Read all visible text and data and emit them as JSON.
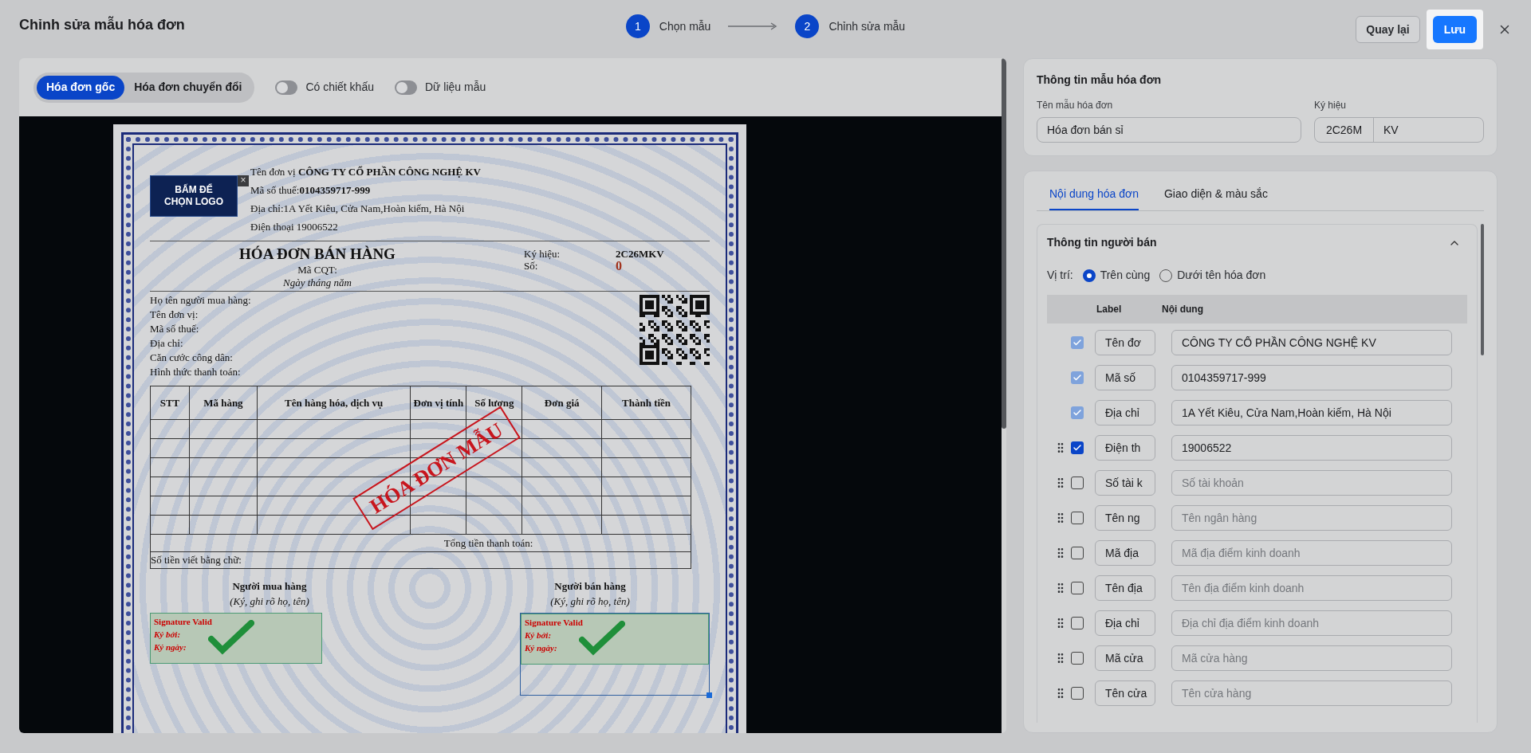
{
  "header": {
    "title": "Chỉnh sửa mẫu hóa đơn",
    "steps": [
      {
        "number": "1",
        "label": "Chọn mẫu"
      },
      {
        "number": "2",
        "label": "Chỉnh sửa mẫu"
      }
    ],
    "back_button": "Quay lại",
    "save_button": "Lưu"
  },
  "toolbar": {
    "tabs": [
      {
        "label": "Hóa đơn gốc",
        "selected": true
      },
      {
        "label": "Hóa đơn chuyển đổi",
        "selected": false
      }
    ],
    "toggles": [
      {
        "label": "Có chiết khấu",
        "on": false
      },
      {
        "label": "Dữ liệu mẫu",
        "on": false
      }
    ]
  },
  "invoice": {
    "logo_text": "BẤM ĐỂ CHỌN LOGO",
    "logo_close": "×",
    "seller_lines": [
      "Tên đơn vị **CÔNG TY CỔ PHẦN CÔNG NGHỆ KV**",
      "Mã số thuế:**0104359717-999**",
      "Địa chỉ:1A Yết Kiêu, Cửa Nam,Hoàn kiếm, Hà Nội",
      "Điện thoại 19006522"
    ],
    "title": "HÓA ĐƠN BÁN HÀNG",
    "cqt": "Mã CQT:",
    "date": "Ngày tháng  năm",
    "symbol_label": "Ký hiệu:",
    "symbol": "2C26MKV",
    "number_label": "Số:",
    "number": "0",
    "buyer_lines": [
      "Họ tên người mua hàng:",
      "Tên đơn vị:",
      "Mã số thuế:",
      "Địa chỉ:",
      "Căn cước công dân:",
      "Hình thức thanh toán:"
    ],
    "table": {
      "columns": [
        "STT",
        "Mã hàng",
        "Tên hàng hóa, dịch vụ",
        "Đơn vị tính",
        "Số lượng",
        "Đơn giá",
        "Thành tiền"
      ],
      "total_label": "Tổng tiền thanh toán:",
      "words_label": "Số tiền viết bằng chữ:"
    },
    "stamp": "HÓA ĐƠN MẪU",
    "signatures": [
      {
        "title": "Người mua hàng",
        "note": "(Ký, ghi rõ họ, tên)",
        "status": "Signature Valid",
        "signed_by": "Ký bởi:",
        "signed_date": "Ký ngày:",
        "selected": false
      },
      {
        "title": "Người bán hàng",
        "note": "(Ký, ghi rõ họ, tên)",
        "status": "Signature Valid",
        "signed_by": "Ký bởi:",
        "signed_date": "Ký ngày:",
        "selected": true
      }
    ]
  },
  "template_info": {
    "title": "Thông tin mẫu hóa đơn",
    "name_label": "Tên mẫu hóa đơn",
    "name_value": "Hóa đơn bán sỉ",
    "symbol_label": "Ký hiệu",
    "symbol_prefix": "2C26M",
    "symbol_suffix": "KV"
  },
  "content_tabs": [
    {
      "label": "Nội dung hóa đơn",
      "selected": true
    },
    {
      "label": "Giao diện & màu sắc",
      "selected": false
    }
  ],
  "seller_section": {
    "title": "Thông tin người bán",
    "expanded": true,
    "position_label": "Vị trí:",
    "options": [
      {
        "label": "Trên cùng",
        "selected": true
      },
      {
        "label": "Dưới tên hóa đơn",
        "selected": false
      }
    ],
    "columns": [
      "Label",
      "Nội dung"
    ],
    "rows": [
      {
        "label": "Tên đơ",
        "value": "CÔNG TY CỔ PHẦN CÔNG NGHỆ KV",
        "checked": true,
        "disabled": true
      },
      {
        "label": "Mã số",
        "value": "0104359717-999",
        "checked": true,
        "disabled": true
      },
      {
        "label": "Địa chỉ",
        "value": "1A Yết Kiêu, Cửa Nam,Hoàn kiếm, Hà Nội",
        "checked": true,
        "disabled": true
      },
      {
        "label": "Điện th",
        "value": "19006522",
        "checked": true,
        "disabled": false
      },
      {
        "label": "Số tài k",
        "placeholder": "Số tài khoản",
        "checked": false,
        "disabled": false
      },
      {
        "label": "Tên ng",
        "placeholder": "Tên ngân hàng",
        "checked": false,
        "disabled": false
      },
      {
        "label": "Mã địa",
        "placeholder": "Mã địa điểm kinh doanh",
        "checked": false,
        "disabled": false
      },
      {
        "label": "Tên địa",
        "placeholder": "Tên địa điểm kinh doanh",
        "checked": false,
        "disabled": false
      },
      {
        "label": "Địa chỉ",
        "placeholder": "Địa chỉ địa điểm kinh doanh",
        "checked": false,
        "disabled": false
      },
      {
        "label": "Mã cửa",
        "placeholder": "Mã cửa hàng",
        "checked": false,
        "disabled": false
      },
      {
        "label": "Tên cửa",
        "placeholder": "Tên cửa hàng",
        "checked": false,
        "disabled": false
      }
    ]
  }
}
